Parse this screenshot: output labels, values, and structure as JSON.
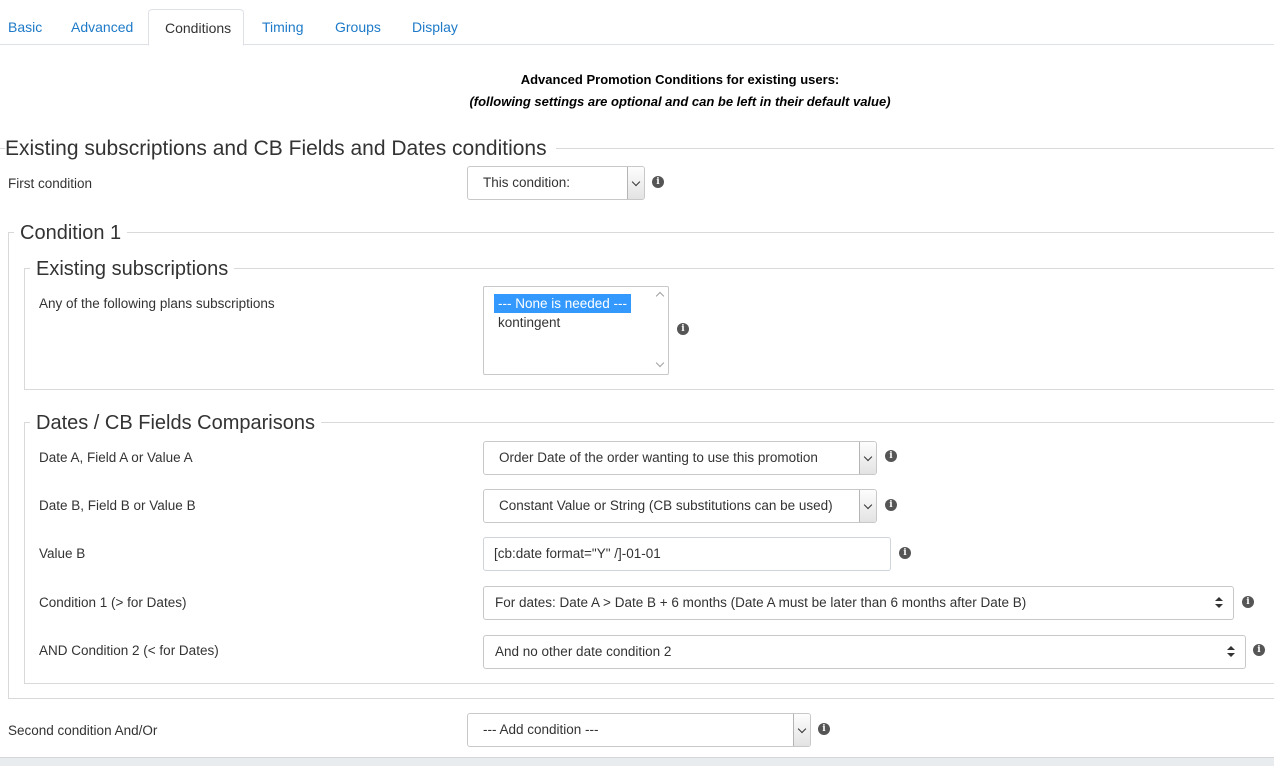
{
  "tabs": [
    "Basic",
    "Advanced",
    "Conditions",
    "Timing",
    "Groups",
    "Display"
  ],
  "active_tab": "Conditions",
  "intro": {
    "title": "Advanced Promotion Conditions for existing users:",
    "subtitle": "(following settings are optional and can be left in their default value)"
  },
  "section_main": {
    "legend": "Existing subscriptions and CB Fields and Dates conditions",
    "first_condition_label": "First condition",
    "first_condition_value": "This condition:"
  },
  "condition1": {
    "legend": "Condition 1",
    "existing_subscriptions": {
      "legend": "Existing subscriptions",
      "plans_label": "Any of the following plans subscriptions",
      "plans_options": [
        "--- None is needed ---",
        "kontingent"
      ],
      "plans_selected": "--- None is needed ---"
    },
    "dates": {
      "legend": "Dates / CB Fields Comparisons",
      "date_a_label": "Date A, Field A or Value A",
      "date_a_value": "Order Date of the order wanting to use this promotion",
      "date_b_label": "Date B, Field B or Value B",
      "date_b_value": "Constant Value or String (CB substitutions can be used)",
      "value_b_label": "Value B",
      "value_b_value": "[cb:date format=\"Y\" /]-01-01",
      "cond1_label": "Condition 1 (> for Dates)",
      "cond1_value": "For dates: Date A > Date B + 6 months (Date A must be later than 6 months after Date B)",
      "cond2_label": "AND Condition 2 (< for Dates)",
      "cond2_value": "And no other date condition 2"
    }
  },
  "second_condition": {
    "label": "Second condition And/Or",
    "value": "--- Add condition ---"
  },
  "icons": {
    "info": "info-icon",
    "info_glyph": "i"
  }
}
